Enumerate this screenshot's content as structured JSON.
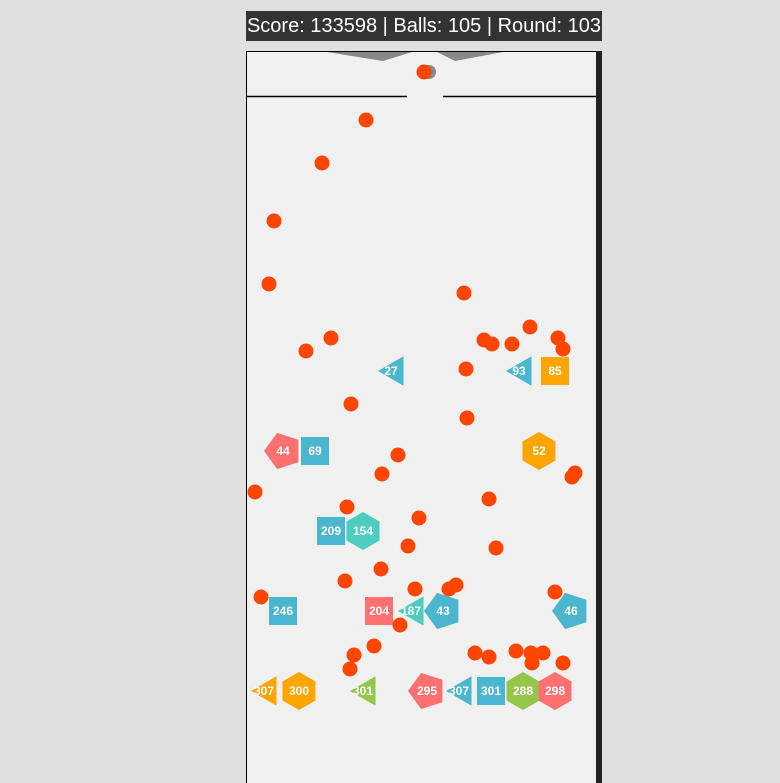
{
  "hud": {
    "score_label": "Score:",
    "score": "133598",
    "balls_label": "Balls:",
    "balls": "105",
    "round_label": "Round:",
    "round": "103",
    "separator": "|"
  },
  "colors": {
    "page_background": "#e0e0e0",
    "board_background": "#f0f0f0",
    "hud_background": "#333333",
    "hud_text": "#ffffff",
    "ball": "#ff4500",
    "launcher_ball": "#888888",
    "funnel": "#888888",
    "wall": "#000000",
    "right_wall": "#222222"
  },
  "shape_colors": {
    "blue": "#4ab6d0",
    "orange": "#ffa500",
    "red": "#ff7070",
    "green": "#93c649",
    "teal": "#4dcdc0"
  },
  "blocks": [
    {
      "shape": "triangle-left",
      "color": "blue",
      "value": "27"
    },
    {
      "shape": "triangle-left",
      "color": "blue",
      "value": "93"
    },
    {
      "shape": "square",
      "color": "orange",
      "value": "85"
    },
    {
      "shape": "pentagon-left",
      "color": "red",
      "value": "44"
    },
    {
      "shape": "square",
      "color": "blue",
      "value": "69"
    },
    {
      "shape": "hexagon",
      "color": "orange",
      "value": "52"
    },
    {
      "shape": "square",
      "color": "blue",
      "value": "209"
    },
    {
      "shape": "hexagon",
      "color": "teal",
      "value": "154"
    },
    {
      "shape": "square",
      "color": "blue",
      "value": "246"
    },
    {
      "shape": "square",
      "color": "red",
      "value": "204"
    },
    {
      "shape": "triangle-left",
      "color": "teal",
      "value": "187"
    },
    {
      "shape": "pentagon-left",
      "color": "blue",
      "value": "43"
    },
    {
      "shape": "pentagon-left",
      "color": "blue",
      "value": "46"
    },
    {
      "shape": "triangle-left",
      "color": "orange",
      "value": "307"
    },
    {
      "shape": "hexagon",
      "color": "orange",
      "value": "300"
    },
    {
      "shape": "triangle-left",
      "color": "green",
      "value": "301"
    },
    {
      "shape": "pentagon-left",
      "color": "red",
      "value": "295"
    },
    {
      "shape": "triangle-left",
      "color": "blue",
      "value": "307"
    },
    {
      "shape": "square",
      "color": "blue",
      "value": "301"
    },
    {
      "shape": "hexagon",
      "color": "green",
      "value": "288"
    },
    {
      "shape": "hexagon",
      "color": "red",
      "value": "298"
    }
  ]
}
